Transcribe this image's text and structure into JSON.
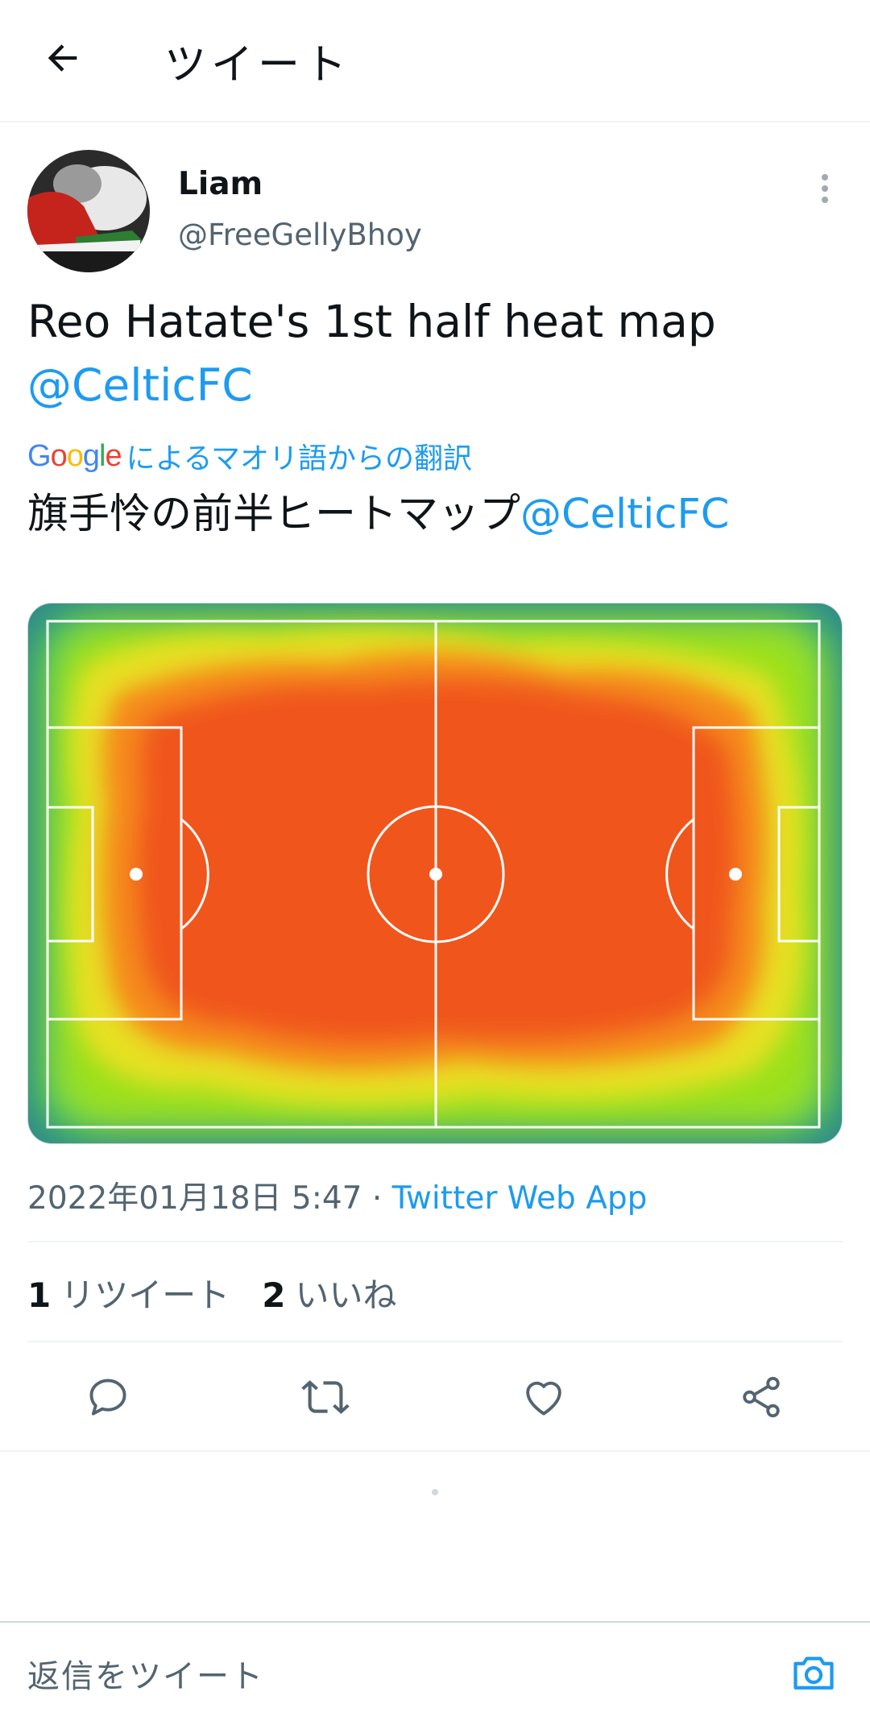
{
  "header": {
    "title": "ツイート",
    "back_icon": "arrow-left-icon"
  },
  "tweet": {
    "author": {
      "name": "Liam",
      "handle": "@FreeGellyBhoy",
      "avatar_icon": "avatar-image"
    },
    "text_line1": "Reo Hatate's 1st half heat map",
    "mention": "@CelticFC",
    "translation": {
      "google": "Google",
      "note": "によるマオリ語からの翻訳",
      "text": "旗手怜の前半ヒートマップ",
      "mention": "@CelticFC"
    },
    "media": {
      "description_icon": "heatmap-image"
    },
    "timestamp": "2022年01月18日 5:47 · ",
    "via": "Twitter Web App",
    "stats": {
      "retweets_count": "1",
      "retweets_label": "リツイート",
      "likes_count": "2",
      "likes_label": "いいね"
    }
  },
  "actions": {
    "reply_icon": "reply-icon",
    "retweet_icon": "retweet-icon",
    "like_icon": "heart-icon",
    "share_icon": "share-icon"
  },
  "reply_bar": {
    "placeholder": "返信をツイート",
    "camera_icon": "camera-icon"
  },
  "colors": {
    "accent": "#1d9bf0",
    "secondary_text": "#536471",
    "divider": "#eff3f4"
  }
}
